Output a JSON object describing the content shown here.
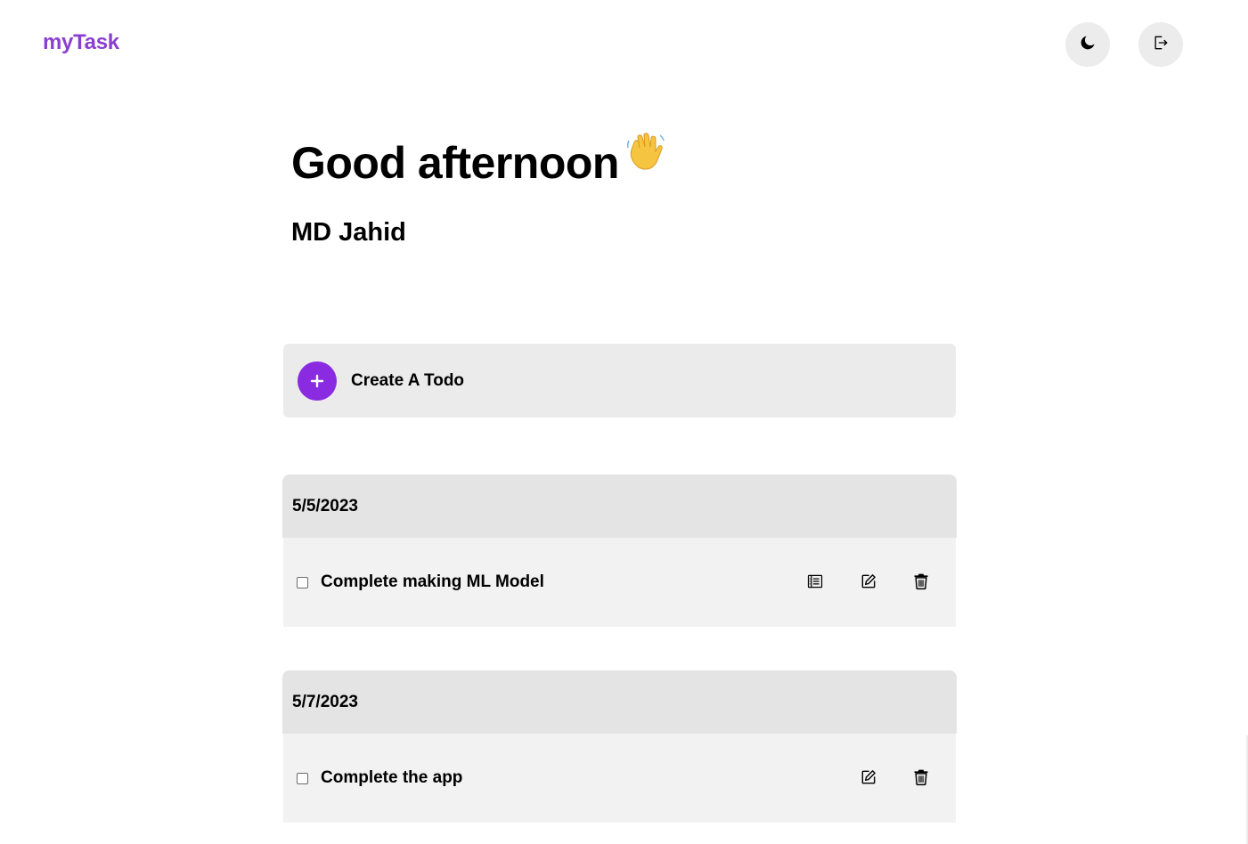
{
  "app": {
    "logo": "myTask"
  },
  "header": {
    "theme_toggle_icon": "moon-icon",
    "logout_icon": "logout-icon"
  },
  "greeting": {
    "title": "Good afternoon",
    "emoji_icon": "waving-hand-icon",
    "user_name": "MD Jahid"
  },
  "create": {
    "icon": "plus-icon",
    "label": "Create A Todo"
  },
  "groups": [
    {
      "date": "5/5/2023",
      "todos": [
        {
          "text": "Complete making ML Model",
          "checked": false,
          "actions": [
            "details-icon",
            "edit-icon",
            "trash-icon"
          ]
        }
      ]
    },
    {
      "date": "5/7/2023",
      "todos": [
        {
          "text": "Complete the app",
          "checked": false,
          "actions": [
            "edit-icon",
            "trash-icon"
          ]
        }
      ]
    }
  ],
  "colors": {
    "brand": "#8a3fd1",
    "accent_button": "#8a2be2",
    "panel": "#ebebeb",
    "group_header": "#e4e4e4",
    "row_bg": "#f2f2f2"
  }
}
